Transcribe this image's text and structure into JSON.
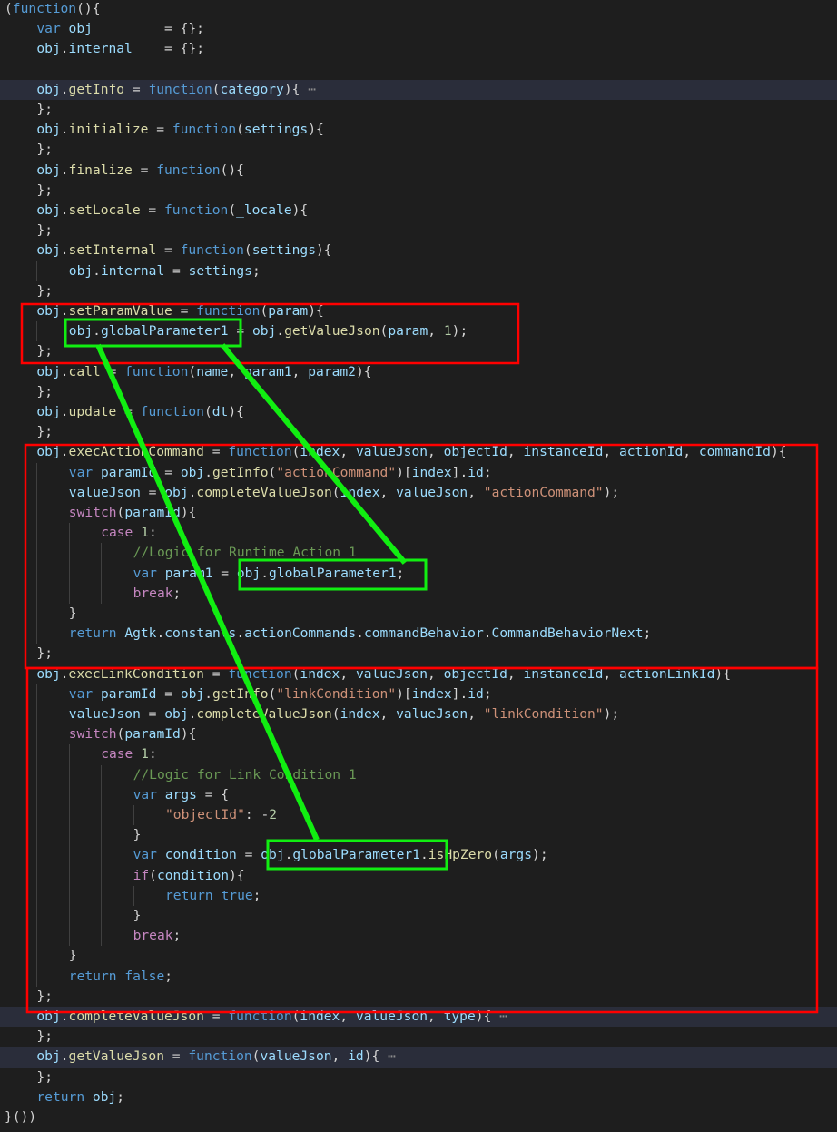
{
  "editor": {
    "language": "javascript",
    "theme_colors": {
      "background": "#1e1e1e",
      "keyword": "#569cd6",
      "variable": "#9cdcfe",
      "function": "#dcdcaa",
      "string": "#ce9178",
      "comment": "#6a9955",
      "number": "#b5cea8",
      "control": "#c586c0",
      "highlight_red": "#ff0000",
      "highlight_green": "#11ee11"
    },
    "lines": [
      {
        "text": "(function(){",
        "indent": 0,
        "hl": false
      },
      {
        "text": "var obj         = {};",
        "indent": 1,
        "hl": false
      },
      {
        "text": "obj.internal    = {};",
        "indent": 1,
        "hl": false
      },
      {
        "text": "",
        "indent": 0,
        "hl": false
      },
      {
        "text": "obj.getInfo = function(category){ ⋯",
        "indent": 1,
        "hl": true
      },
      {
        "text": "};",
        "indent": 1,
        "hl": false
      },
      {
        "text": "obj.initialize = function(settings){",
        "indent": 1,
        "hl": false
      },
      {
        "text": "};",
        "indent": 1,
        "hl": false
      },
      {
        "text": "obj.finalize = function(){",
        "indent": 1,
        "hl": false
      },
      {
        "text": "};",
        "indent": 1,
        "hl": false
      },
      {
        "text": "obj.setLocale = function(_locale){",
        "indent": 1,
        "hl": false
      },
      {
        "text": "};",
        "indent": 1,
        "hl": false
      },
      {
        "text": "obj.setInternal = function(settings){",
        "indent": 1,
        "hl": false
      },
      {
        "text": "obj.internal = settings;",
        "indent": 2,
        "hl": false
      },
      {
        "text": "};",
        "indent": 1,
        "hl": false
      },
      {
        "text": "obj.setParamValue = function(param){",
        "indent": 1,
        "hl": false
      },
      {
        "text": "obj.globalParameter1 = obj.getValueJson(param, 1);",
        "indent": 2,
        "hl": false
      },
      {
        "text": "};",
        "indent": 1,
        "hl": false
      },
      {
        "text": "obj.call = function(name, param1, param2){",
        "indent": 1,
        "hl": false
      },
      {
        "text": "};",
        "indent": 1,
        "hl": false
      },
      {
        "text": "obj.update = function(dt){",
        "indent": 1,
        "hl": false
      },
      {
        "text": "};",
        "indent": 1,
        "hl": false
      },
      {
        "text": "obj.execActionCommand = function(index, valueJson, objectId, instanceId, actionId, commandId){",
        "indent": 1,
        "hl": false
      },
      {
        "text": "var paramId = obj.getInfo(\"actionCommand\")[index].id;",
        "indent": 2,
        "hl": false
      },
      {
        "text": "valueJson = obj.completeValueJson(index, valueJson, \"actionCommand\");",
        "indent": 2,
        "hl": false
      },
      {
        "text": "switch(paramId){",
        "indent": 2,
        "hl": false
      },
      {
        "text": "case 1:",
        "indent": 3,
        "hl": false
      },
      {
        "text": "//Logic for Runtime Action 1",
        "indent": 4,
        "hl": false
      },
      {
        "text": "var param1 = obj.globalParameter1;",
        "indent": 4,
        "hl": false
      },
      {
        "text": "break;",
        "indent": 4,
        "hl": false
      },
      {
        "text": "}",
        "indent": 2,
        "hl": false
      },
      {
        "text": "return Agtk.constants.actionCommands.commandBehavior.CommandBehaviorNext;",
        "indent": 2,
        "hl": false
      },
      {
        "text": "};",
        "indent": 1,
        "hl": false
      },
      {
        "text": "obj.execLinkCondition = function(index, valueJson, objectId, instanceId, actionLinkId){",
        "indent": 1,
        "hl": false
      },
      {
        "text": "var paramId = obj.getInfo(\"linkCondition\")[index].id;",
        "indent": 2,
        "hl": false
      },
      {
        "text": "valueJson = obj.completeValueJson(index, valueJson, \"linkCondition\");",
        "indent": 2,
        "hl": false
      },
      {
        "text": "switch(paramId){",
        "indent": 2,
        "hl": false
      },
      {
        "text": "case 1:",
        "indent": 3,
        "hl": false
      },
      {
        "text": "//Logic for Link Condition 1",
        "indent": 4,
        "hl": false
      },
      {
        "text": "var args = {",
        "indent": 4,
        "hl": false
      },
      {
        "text": "\"objectId\": -2",
        "indent": 5,
        "hl": false
      },
      {
        "text": "}",
        "indent": 4,
        "hl": false
      },
      {
        "text": "var condition = obj.globalParameter1.isHpZero(args);",
        "indent": 4,
        "hl": false
      },
      {
        "text": "if(condition){",
        "indent": 4,
        "hl": false
      },
      {
        "text": "return true;",
        "indent": 5,
        "hl": false
      },
      {
        "text": "}",
        "indent": 4,
        "hl": false
      },
      {
        "text": "break;",
        "indent": 4,
        "hl": false
      },
      {
        "text": "}",
        "indent": 2,
        "hl": false
      },
      {
        "text": "return false;",
        "indent": 2,
        "hl": false
      },
      {
        "text": "};",
        "indent": 1,
        "hl": false
      },
      {
        "text": "obj.completeValueJson = function(index, valueJson, type){ ⋯",
        "indent": 1,
        "hl": true
      },
      {
        "text": "};",
        "indent": 1,
        "hl": false
      },
      {
        "text": "obj.getValueJson = function(valueJson, id){ ⋯",
        "indent": 1,
        "hl": true
      },
      {
        "text": "};",
        "indent": 1,
        "hl": false
      },
      {
        "text": "return obj;",
        "indent": 1,
        "hl": false
      },
      {
        "text": "}())",
        "indent": 0,
        "hl": false
      }
    ]
  },
  "annotations": {
    "red_boxes": [
      "setParamValue-block",
      "execActionCommand-block",
      "execLinkCondition-block"
    ],
    "green_boxes": [
      "obj.globalParameter1",
      "obj.globalParameter1;",
      "obj.globalParameter1."
    ]
  }
}
